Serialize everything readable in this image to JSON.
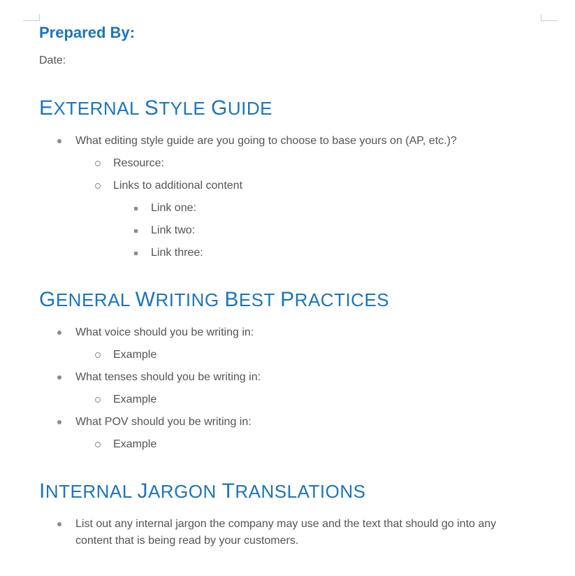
{
  "header": {
    "prepared_by": "Prepared By:",
    "date_label": "Date:"
  },
  "sections": {
    "external_style_guide": {
      "heading_parts": [
        "E",
        "XTERNAL ",
        "S",
        "TYLE ",
        "G",
        "UIDE"
      ],
      "item1": "What editing style guide are you going to choose to base yours on (AP, etc.)?",
      "sub_resource": "Resource:",
      "sub_links_header": "Links to additional content",
      "link_one": "Link one:",
      "link_two": "Link two:",
      "link_three": "Link three:"
    },
    "general_writing": {
      "heading_parts": [
        "G",
        "ENERAL ",
        "W",
        "RITING ",
        "B",
        "EST ",
        "P",
        "RACTICES"
      ],
      "voice_q": "What voice should you be writing in:",
      "voice_ex": "Example",
      "tense_q": "What tenses should you be writing in:",
      "tense_ex": "Example",
      "pov_q": "What POV should you be writing in:",
      "pov_ex": "Example"
    },
    "internal_jargon": {
      "heading_parts": [
        "I",
        "NTERNAL ",
        "J",
        "ARGON ",
        "T",
        "RANSLATIONS"
      ],
      "item1": "List out any internal jargon the company may use and the text that should go into any content that is being read by your customers."
    }
  }
}
